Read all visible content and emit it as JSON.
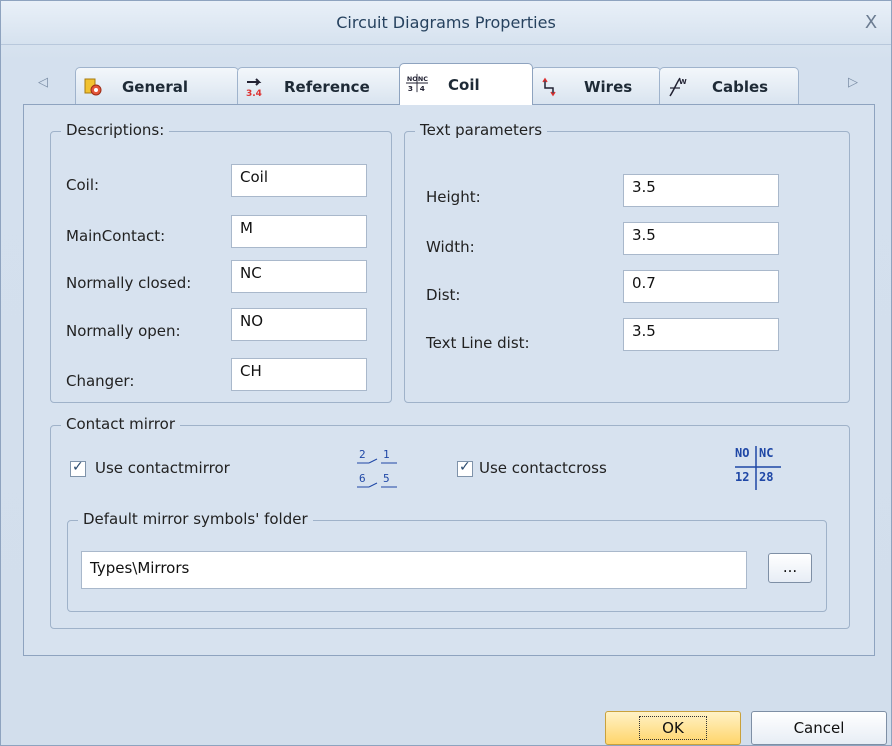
{
  "window": {
    "title": "Circuit Diagrams Properties",
    "close_glyph": "X"
  },
  "tabs": [
    {
      "label": "General",
      "icon": "general-icon"
    },
    {
      "label": "Reference",
      "icon": "reference-icon"
    },
    {
      "label": "Coil",
      "icon": "coil-icon",
      "active": true
    },
    {
      "label": "Wires",
      "icon": "wires-icon"
    },
    {
      "label": "Cables",
      "icon": "cables-icon"
    }
  ],
  "descriptions": {
    "title": "Descriptions:",
    "fields": [
      {
        "label": "Coil:",
        "value": "Coil"
      },
      {
        "label": "MainContact:",
        "value": "M"
      },
      {
        "label": "Normally closed:",
        "value": "NC"
      },
      {
        "label": "Normally open:",
        "value": "NO"
      },
      {
        "label": "Changer:",
        "value": "CH"
      }
    ]
  },
  "text_parameters": {
    "title": "Text parameters",
    "fields": [
      {
        "label": "Height:",
        "value": "3.5"
      },
      {
        "label": "Width:",
        "value": "3.5"
      },
      {
        "label": "Dist:",
        "value": "0.7"
      },
      {
        "label": "Text Line dist:",
        "value": "3.5"
      }
    ]
  },
  "contact_mirror": {
    "title": "Contact mirror",
    "use_contactmirror": {
      "label": "Use contactmirror",
      "checked": true
    },
    "use_contactcross": {
      "label": "Use contactcross",
      "checked": true
    },
    "mirror_symbol": {
      "top_left": "2",
      "top_right": "1",
      "bottom_left": "6",
      "bottom_right": "5"
    },
    "cross_symbol": {
      "top_left": "NO",
      "top_right": "NC",
      "bottom_left": "12",
      "bottom_right": "28"
    },
    "folder_group": {
      "title": "Default mirror symbols' folder",
      "path": "Types\\Mirrors",
      "browse_label": "..."
    }
  },
  "buttons": {
    "ok": "OK",
    "cancel": "Cancel"
  },
  "colors": {
    "accent": "#ffd56b",
    "background": "#d4e0ee",
    "border": "#8ea3bf"
  }
}
